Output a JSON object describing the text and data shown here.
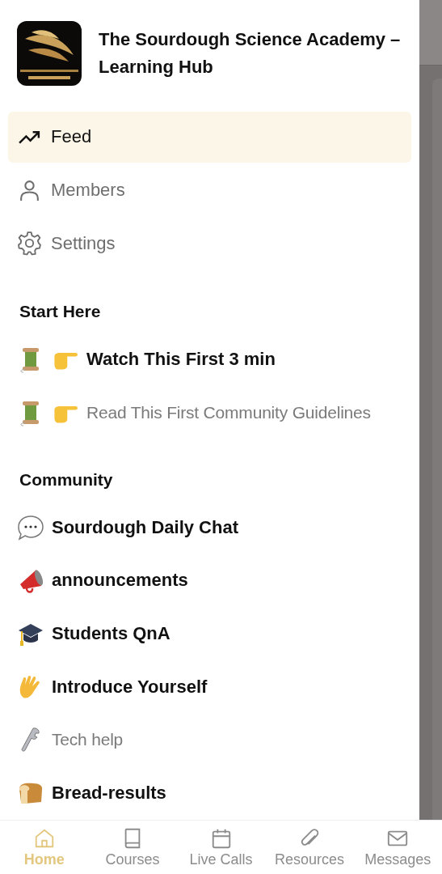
{
  "community": {
    "title": "The Sourdough Science Academy – Learning Hub"
  },
  "nav": [
    {
      "label": "Feed",
      "selected": true
    },
    {
      "label": "Members",
      "selected": false
    },
    {
      "label": "Settings",
      "selected": false
    }
  ],
  "sections": [
    {
      "heading": "Start Here",
      "channels": [
        {
          "label": "Watch This First 3 min",
          "unread": true
        },
        {
          "label": "Read This First Community Guidelines",
          "unread": false
        }
      ]
    },
    {
      "heading": "Community",
      "channels": [
        {
          "label": "Sourdough Daily Chat",
          "unread": true
        },
        {
          "label": "announcements",
          "unread": true
        },
        {
          "label": "Students QnA",
          "unread": true
        },
        {
          "label": "Introduce Yourself",
          "unread": true
        },
        {
          "label": "Tech help",
          "unread": false
        },
        {
          "label": "Bread-results",
          "unread": true
        }
      ]
    }
  ],
  "tabs": [
    {
      "label": "Home",
      "selected": true
    },
    {
      "label": "Courses",
      "selected": false
    },
    {
      "label": "Live Calls",
      "selected": false
    },
    {
      "label": "Resources",
      "selected": false
    },
    {
      "label": "Messages",
      "selected": false
    }
  ]
}
